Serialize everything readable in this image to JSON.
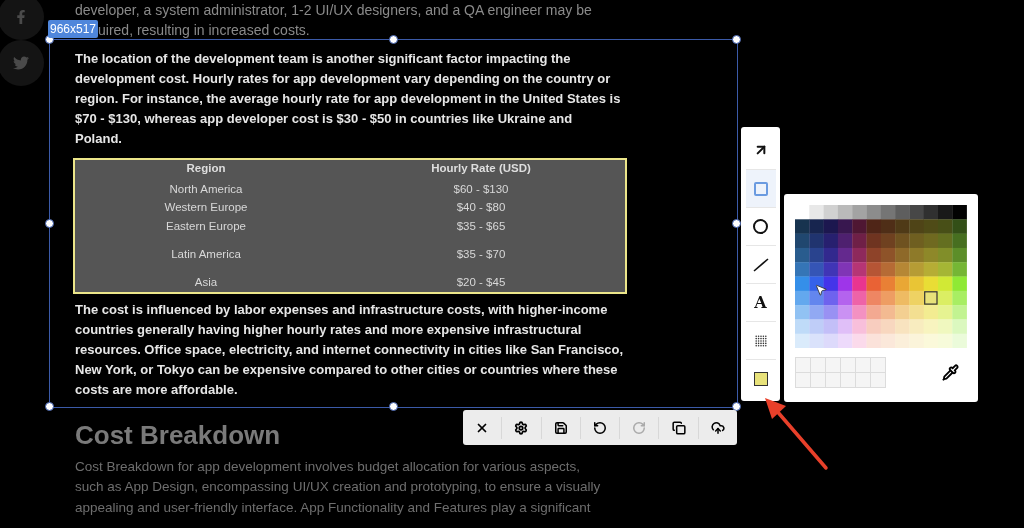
{
  "social": [
    {
      "kind": "facebook"
    },
    {
      "kind": "twitter"
    }
  ],
  "intro_lines": [
    "developer, a system administrator, 1-2 UI/UX designers, and a QA engineer may be",
    "uired, resulting in increased costs."
  ],
  "selection": {
    "size_label": "966x517"
  },
  "paragraph_1": [
    "The location of the development team is another significant factor impacting the",
    "development cost. Hourly rates for app development vary depending on the country or",
    "region. For instance, the average hourly rate for app development in the United States is",
    "$70 - $130, whereas app developer cost is $30 - $50 in countries like Ukraine and",
    "Poland."
  ],
  "table": {
    "columns": [
      "Region",
      "Hourly Rate (USD)"
    ],
    "rows": [
      [
        "North America",
        "$60 - $130"
      ],
      [
        "Western Europe",
        "$40 - $80"
      ],
      [
        "Eastern Europe",
        "$35 - $65"
      ],
      [
        "Latin America",
        "$35 - $70"
      ],
      [
        "Asia",
        "$20 - $45"
      ]
    ]
  },
  "paragraph_2": [
    "The cost is influenced by labor expenses and infrastructure costs, with higher-income",
    "countries generally having higher hourly rates and more expensive infrastructural",
    "resources. Office space, electricity, and internet connectivity in cities like San Francisco,",
    "New York, or Tokyo can be expensive compared to other cities or countries where these",
    "costs are more affordable."
  ],
  "heading": "Cost Breakdown",
  "paragraph_3": [
    "Cost Breakdown for app development involves budget allocation for various aspects,",
    "such as App Design, encompassing UI/UX creation and prototyping, to ensure a visually",
    "appealing and user-friendly interface. App Functionality and Features play a significant"
  ],
  "tools": [
    {
      "kind": "arrow",
      "selected": false
    },
    {
      "kind": "rectangle",
      "selected": true
    },
    {
      "kind": "circle",
      "selected": false
    },
    {
      "kind": "line",
      "selected": false
    },
    {
      "kind": "text",
      "label": "A",
      "selected": false
    },
    {
      "kind": "pattern",
      "selected": false
    },
    {
      "kind": "color",
      "selected": false,
      "color": "#e8e27a"
    }
  ],
  "actions": [
    {
      "kind": "close",
      "disabled": false
    },
    {
      "kind": "settings",
      "disabled": false
    },
    {
      "kind": "save",
      "disabled": false
    },
    {
      "kind": "undo",
      "disabled": false
    },
    {
      "kind": "redo",
      "disabled": true
    },
    {
      "kind": "copy",
      "disabled": false
    },
    {
      "kind": "upload",
      "disabled": false
    }
  ]
}
